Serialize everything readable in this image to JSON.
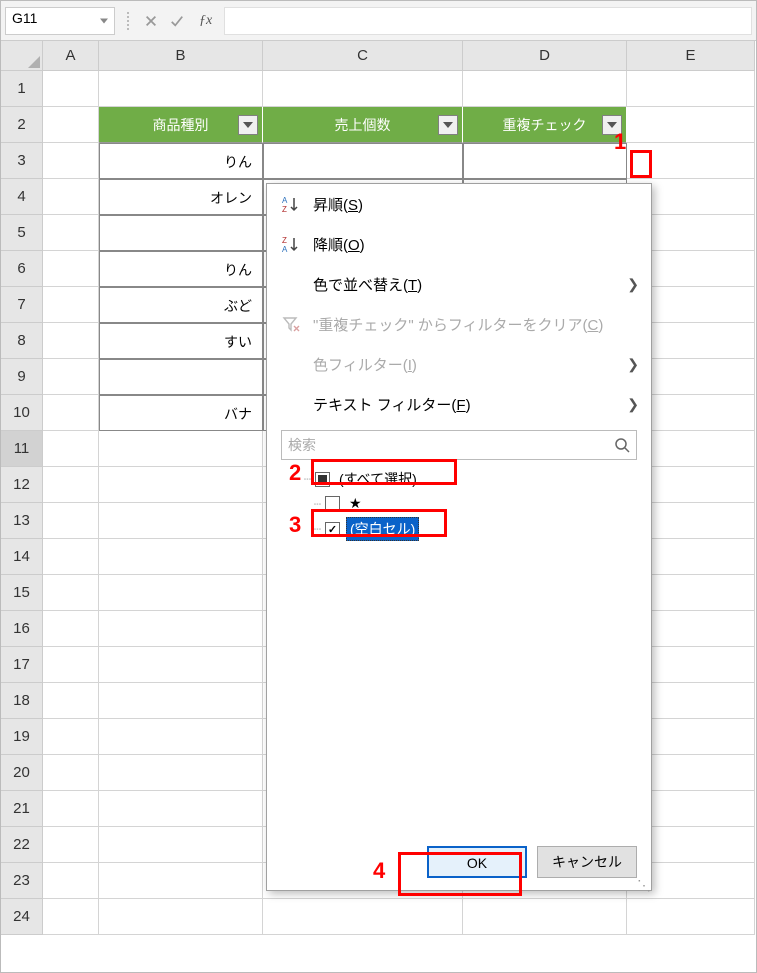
{
  "nameBox": "G11",
  "columns": [
    "A",
    "B",
    "C",
    "D",
    "E"
  ],
  "rowCount": 24,
  "tableHeaders": {
    "b": "商品種別",
    "c": "売上個数",
    "d": "重複チェック"
  },
  "tableData": {
    "3": "りん",
    "4": "オレン",
    "5": "",
    "6": "りん",
    "7": "ぶど",
    "8": "すい",
    "9": "",
    "10": "バナ"
  },
  "filterMenu": {
    "sortAsc": {
      "label": "昇順(",
      "key": "S",
      "suffix": ")"
    },
    "sortDesc": {
      "label": "降順(",
      "key": "O",
      "suffix": ")"
    },
    "sortColor": {
      "label": "色で並べ替え(",
      "key": "T",
      "suffix": ")"
    },
    "clearFilter": {
      "prefix": "\"重複チェック\" からフィルターをクリア(",
      "key": "C",
      "suffix": ")"
    },
    "colorFilter": {
      "label": "色フィルター(",
      "key": "I",
      "suffix": ")"
    },
    "textFilter": {
      "label": "テキスト フィルター(",
      "key": "F",
      "suffix": ")"
    },
    "searchPlaceholder": "検索",
    "items": {
      "all": "(すべて選択)",
      "star": "★",
      "blank": "(空白セル)"
    },
    "ok": "OK",
    "cancel": "キャンセル"
  },
  "callouts": {
    "one": "1",
    "two": "2",
    "three": "3",
    "four": "4"
  }
}
